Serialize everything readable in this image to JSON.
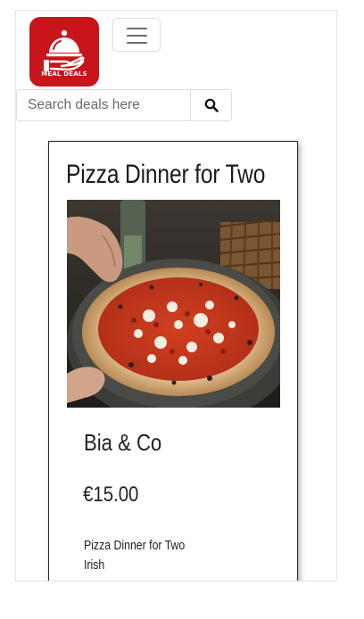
{
  "logo": {
    "text": "MEAL DEALS",
    "icon": "cloche-with-hand-icon",
    "brand_color": "#c8151b"
  },
  "navbar": {
    "toggler_icon": "hamburger-menu-icon"
  },
  "search": {
    "placeholder": "Search deals here",
    "value": "",
    "button_icon": "search-icon"
  },
  "deal": {
    "title": "Pizza Dinner for Two",
    "restaurant": "Bia & Co",
    "price": "€15.00",
    "description": "Pizza Dinner for Two",
    "cuisine": "Irish"
  }
}
